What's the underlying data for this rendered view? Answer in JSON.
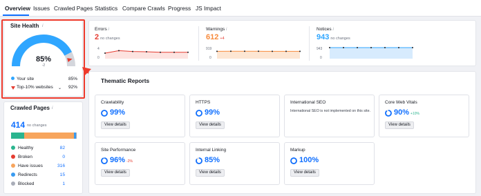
{
  "tabs": [
    "Overview",
    "Issues",
    "Crawled Pages",
    "Statistics",
    "Compare Crawls",
    "Progress",
    "JS Impact"
  ],
  "site_health": {
    "title": "Site Health",
    "info": "i",
    "value": "85%",
    "change": "-2",
    "percent": 85,
    "top10_percent": 92,
    "legend": [
      {
        "label": "Your site",
        "value": "85%",
        "color": "#2fa6ff"
      },
      {
        "label": "Top-10% websites",
        "value": "92%",
        "color": "#e53c31"
      }
    ]
  },
  "crawled_pages": {
    "title": "Crawled Pages",
    "info": "i",
    "total": "414",
    "change": "no changes",
    "stats": [
      {
        "label": "Healthy",
        "value": "82",
        "count": 82,
        "color": "#2bb58f"
      },
      {
        "label": "Broken",
        "value": "0",
        "count": 0,
        "color": "#e53c31"
      },
      {
        "label": "Have issues",
        "value": "316",
        "count": 316,
        "color": "#f7a55d"
      },
      {
        "label": "Redirects",
        "value": "15",
        "count": 15,
        "color": "#3a9bf0"
      },
      {
        "label": "Blocked",
        "value": "1",
        "count": 1,
        "color": "#a9adb8"
      }
    ]
  },
  "metrics": [
    {
      "label": "Errors",
      "info": "i",
      "value": "2",
      "change": "no changes",
      "ticks": [
        "4",
        "0"
      ],
      "color": "#e53c31",
      "fill": "#fde3e0",
      "change_color": "#6c727f",
      "series": [
        2,
        2.9,
        2.6,
        2.5,
        2.3,
        2.3,
        2.3
      ]
    },
    {
      "label": "Warnings",
      "info": "i",
      "value": "612",
      "change": "+4",
      "ticks": [
        "919",
        "0"
      ],
      "color": "#f78a3b",
      "fill": "#fde6d3",
      "change_color": "#e53c31",
      "series": [
        612,
        619,
        617,
        614,
        612,
        612,
        612
      ]
    },
    {
      "label": "Notices",
      "info": "i",
      "value": "943",
      "change": "no changes",
      "ticks": [
        "943",
        "0"
      ],
      "color": "#2fa6ff",
      "fill": "#d7ebfd",
      "change_color": "#6c727f",
      "series": [
        943,
        943,
        943,
        943,
        943,
        943,
        943
      ]
    }
  ],
  "thematic": {
    "title": "Thematic Reports",
    "button_label": "View details",
    "tiles": [
      {
        "name": "Crawlability",
        "value": "99%",
        "percent": 99,
        "delta": ""
      },
      {
        "name": "HTTPS",
        "value": "99%",
        "percent": 99,
        "delta": ""
      },
      {
        "name": "International SEO",
        "value": "",
        "note": "International SEO is not implemented on this site."
      },
      {
        "name": "Core Web Vitals",
        "value": "90%",
        "percent": 90,
        "delta": "+10%",
        "delta_color": "#2bb58f"
      },
      {
        "name": "Site Performance",
        "value": "96%",
        "percent": 96,
        "delta": "-2%",
        "delta_color": "#e53c31"
      },
      {
        "name": "Internal Linking",
        "value": "85%",
        "percent": 85,
        "delta": ""
      },
      {
        "name": "Markup",
        "value": "100%",
        "percent": 100,
        "delta": ""
      }
    ]
  }
}
